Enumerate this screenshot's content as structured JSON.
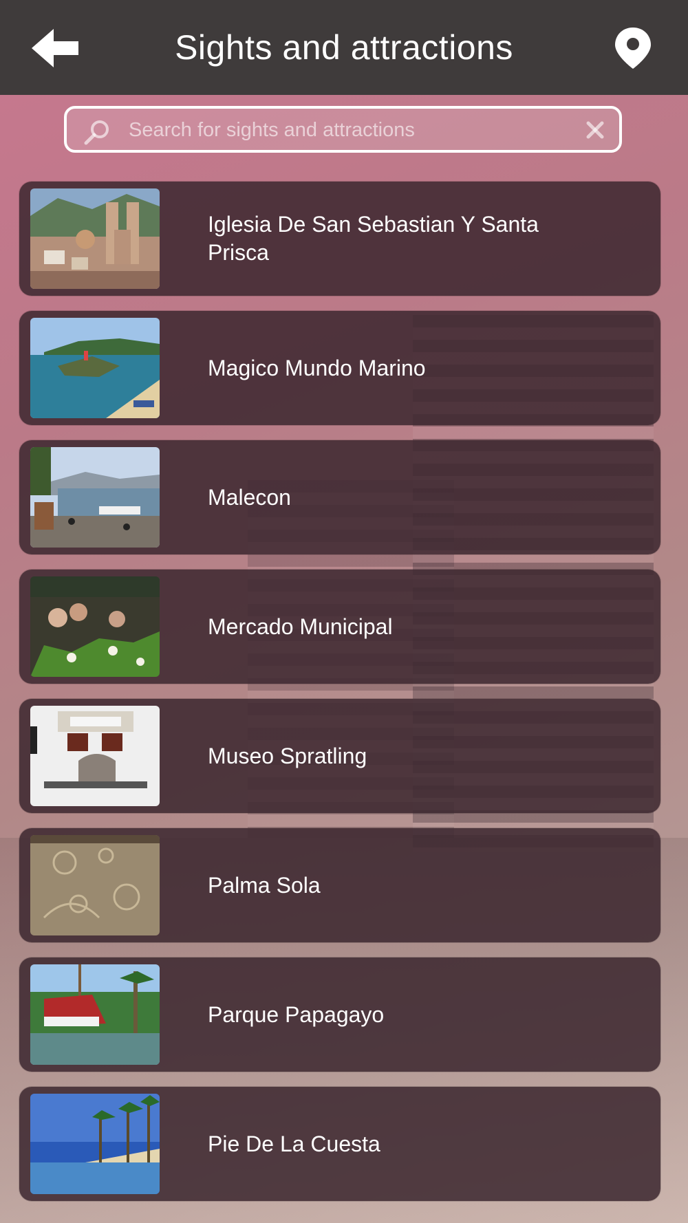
{
  "header": {
    "title": "Sights and attractions",
    "back_icon": "back-arrow-icon",
    "map_icon": "map-pin-icon"
  },
  "search": {
    "placeholder": "Search for sights and attractions",
    "value": ""
  },
  "items": [
    {
      "label": "Iglesia De San Sebastian Y Santa Prisca"
    },
    {
      "label": "Magico Mundo Marino"
    },
    {
      "label": "Malecon"
    },
    {
      "label": "Mercado Municipal"
    },
    {
      "label": "Museo Spratling"
    },
    {
      "label": "Palma Sola"
    },
    {
      "label": "Parque Papagayo"
    },
    {
      "label": "Pie De La Cuesta"
    }
  ],
  "colors": {
    "header_bg": "#3f3b3b",
    "row_bg": "#3c2830",
    "text": "#ffffff"
  }
}
